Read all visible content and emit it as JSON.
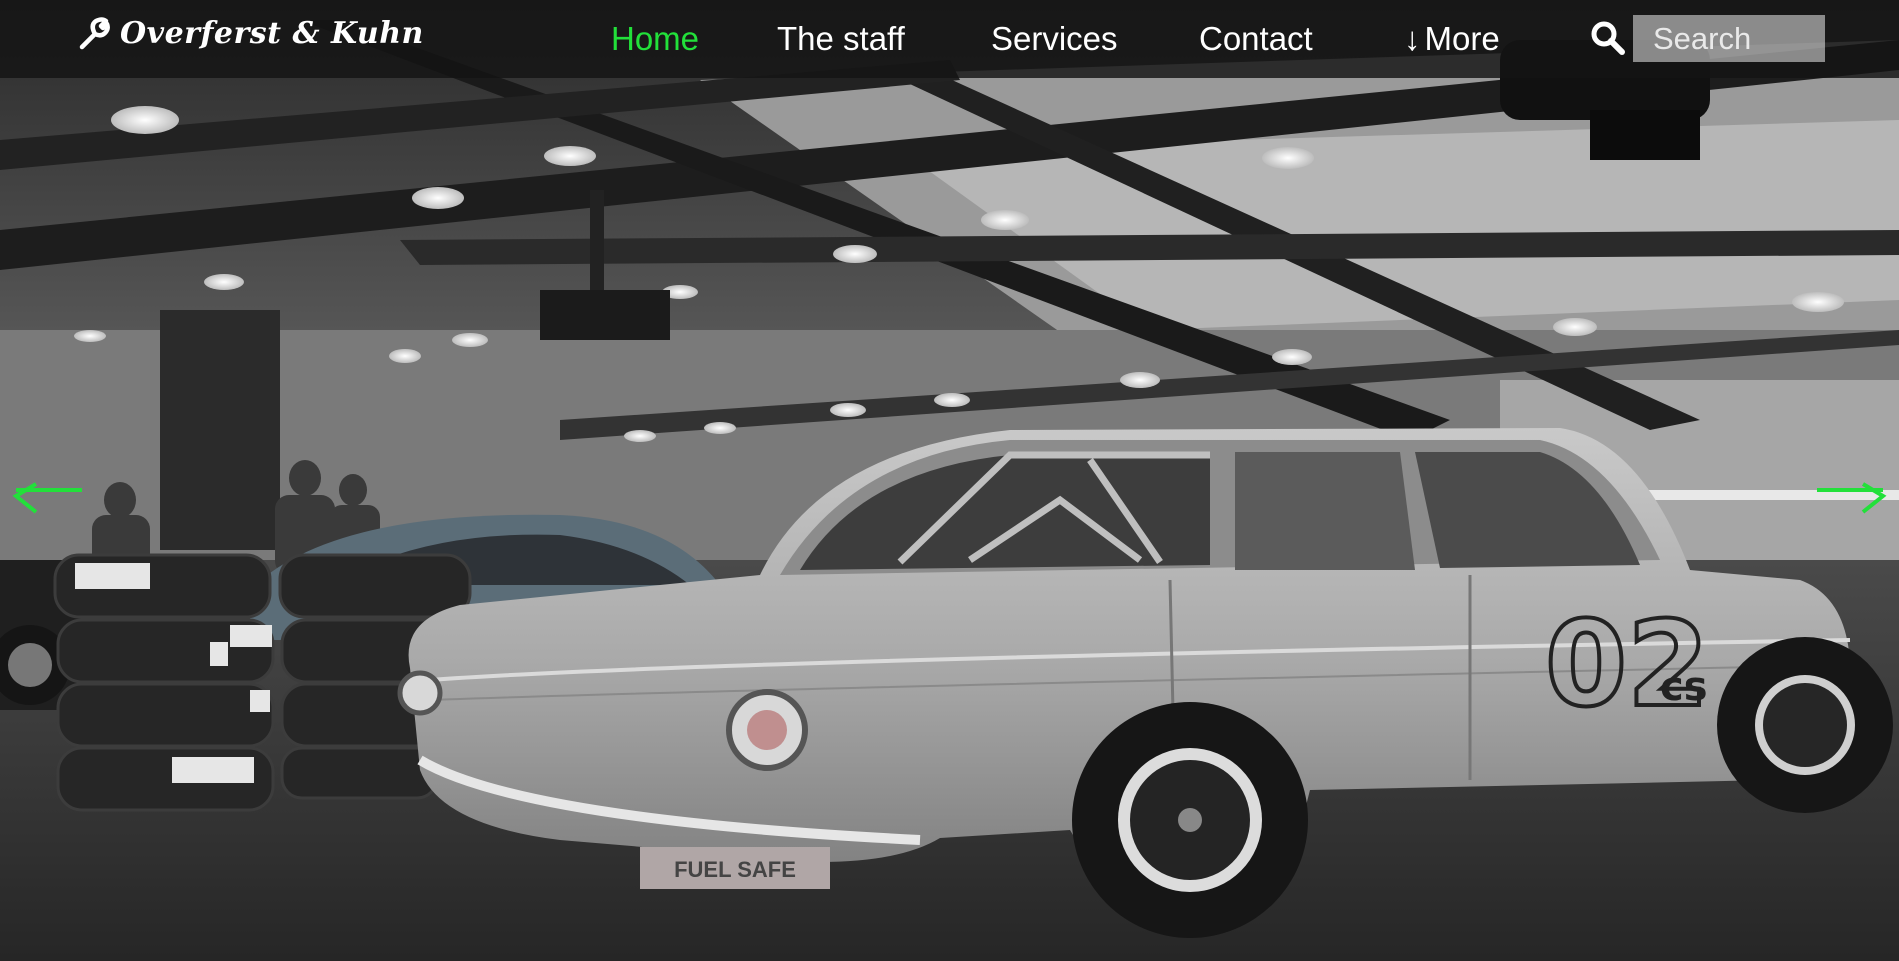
{
  "brand": {
    "name": "Overferst & Kuhn",
    "icon": "wrench-icon"
  },
  "nav": {
    "items": [
      {
        "label": "Home",
        "active": true
      },
      {
        "label": "The staff",
        "active": false
      },
      {
        "label": "Services",
        "active": false
      },
      {
        "label": "Contact",
        "active": false
      },
      {
        "label": "More",
        "active": false,
        "icon": "arrow-down-icon",
        "arrow_glyph": "↓"
      }
    ]
  },
  "search": {
    "placeholder": "Search",
    "value": "",
    "icon": "search-icon"
  },
  "carousel": {
    "prev_icon": "arrow-left-icon",
    "next_icon": "arrow-right-icon",
    "car_number": "02",
    "car_suffix": "cs",
    "plate_text": "FUEL SAFE"
  },
  "colors": {
    "accent": "#22e03a",
    "navbar_bg": "#141414",
    "text": "#ffffff"
  }
}
